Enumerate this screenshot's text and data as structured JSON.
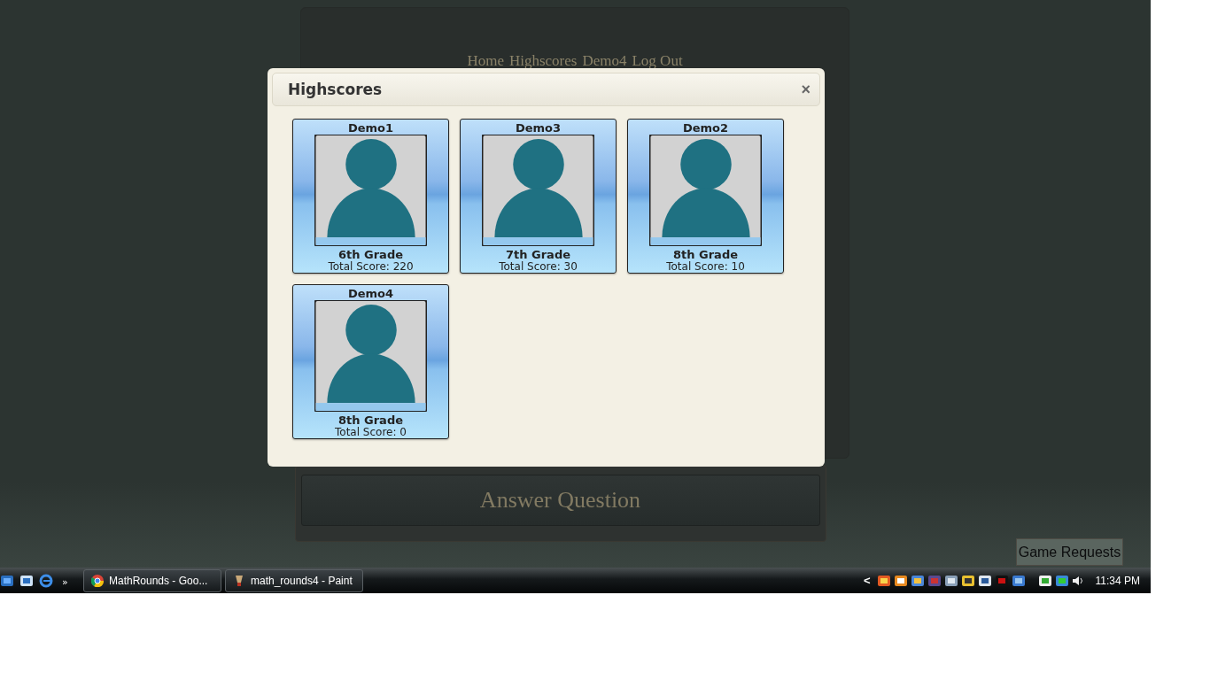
{
  "background_page": {
    "nav": [
      "Home",
      "Highscores",
      "Demo4",
      "Log Out"
    ],
    "answer_button": "Answer Question",
    "game_requests_button": "Game Requests"
  },
  "dialog": {
    "title": "Highscores",
    "close": "×",
    "players": [
      {
        "name": "Demo1",
        "grade": "6th Grade",
        "score": "Total Score: 220"
      },
      {
        "name": "Demo3",
        "grade": "7th Grade",
        "score": "Total Score: 30"
      },
      {
        "name": "Demo2",
        "grade": "8th Grade",
        "score": "Total Score: 10"
      },
      {
        "name": "Demo4",
        "grade": "8th Grade",
        "score": "Total Score: 0"
      }
    ]
  },
  "taskbar": {
    "more": "»",
    "tasks": [
      {
        "label": "MathRounds - Goo...",
        "kind": "browser"
      },
      {
        "label": "math_rounds4 - Paint",
        "kind": "paint"
      }
    ],
    "tray_toggle": "<",
    "clock": "11:34 PM"
  }
}
